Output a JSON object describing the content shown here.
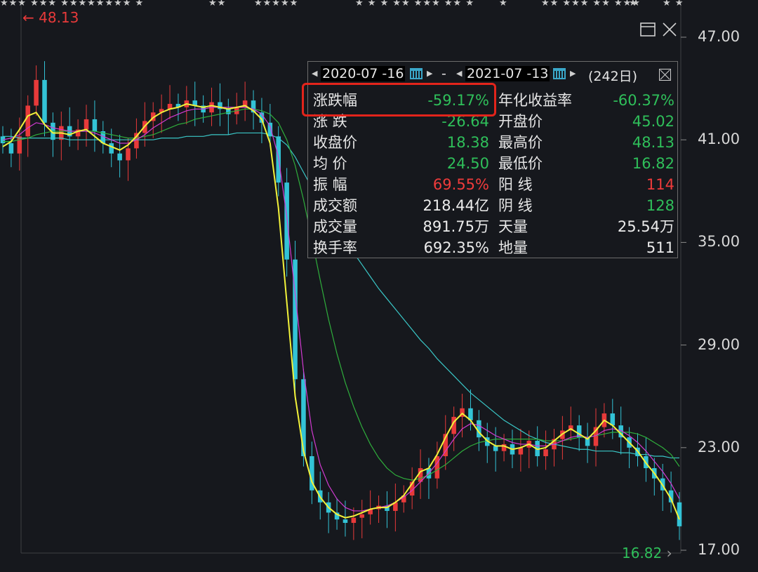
{
  "chart_data": {
    "type": "candlestick",
    "y_axis": {
      "ticks": [
        "47.00",
        "41.00",
        "35.00",
        "29.00",
        "23.00",
        "17.00"
      ],
      "ylim": [
        16.6,
        47.6
      ]
    },
    "max_marker": "48.13",
    "min_marker": "16.82",
    "closes": [
      40.8,
      40.2,
      41.2,
      43.0,
      44.5,
      42.0,
      41.0,
      41.8,
      41.2,
      41.6,
      42.2,
      41.5,
      40.8,
      40.2,
      39.8,
      40.5,
      41.4,
      42.1,
      42.6,
      42.8,
      43.1,
      42.9,
      43.3,
      43.0,
      42.6,
      43.2,
      42.8,
      42.5,
      42.9,
      43.3,
      42.6,
      42.0,
      41.2,
      38.5,
      34.0,
      27.0,
      22.5,
      20.5,
      19.8,
      19.2,
      18.8,
      18.6,
      18.9,
      19.1,
      19.4,
      19.6,
      19.3,
      19.8,
      20.2,
      21.0,
      21.8,
      21.2,
      22.5,
      23.8,
      24.8,
      25.3,
      24.6,
      23.6,
      23.1,
      22.8,
      23.2,
      22.6,
      23.0,
      23.4,
      22.5,
      22.9,
      23.5,
      24.0,
      24.3,
      23.6,
      23.1,
      24.2,
      25.0,
      24.3,
      23.6,
      23.0,
      22.5,
      21.8,
      21.2,
      20.5,
      19.8,
      18.4
    ],
    "ma_fast": [
      40.6,
      40.9,
      41.6,
      42.4,
      42.6,
      41.9,
      41.4,
      41.4,
      41.3,
      41.5,
      41.6,
      41.2,
      40.8,
      40.6,
      40.4,
      40.7,
      41.2,
      41.8,
      42.3,
      42.6,
      42.8,
      42.9,
      43.1,
      43.0,
      42.9,
      43.0,
      42.9,
      42.8,
      42.9,
      43.0,
      42.7,
      42.2,
      40.8,
      37.0,
      31.5,
      26.0,
      22.8,
      21.0,
      20.1,
      19.5,
      19.1,
      18.9,
      19.0,
      19.2,
      19.4,
      19.5,
      19.5,
      19.8,
      20.2,
      20.9,
      21.6,
      21.8,
      22.6,
      23.6,
      24.5,
      25.0,
      24.6,
      23.9,
      23.4,
      23.1,
      23.1,
      22.9,
      23.0,
      23.2,
      22.9,
      23.0,
      23.4,
      23.8,
      24.1,
      23.8,
      23.5,
      24.0,
      24.6,
      24.3,
      23.8,
      23.3,
      22.8,
      22.1,
      21.5,
      20.8,
      20.0,
      18.8
    ],
    "ma_mid": [
      41.0,
      41.1,
      41.3,
      41.7,
      42.0,
      41.9,
      41.7,
      41.6,
      41.5,
      41.5,
      41.5,
      41.4,
      41.2,
      41.0,
      40.8,
      40.8,
      41.0,
      41.3,
      41.7,
      42.0,
      42.3,
      42.5,
      42.7,
      42.8,
      42.8,
      42.9,
      42.9,
      42.9,
      42.9,
      42.9,
      42.8,
      42.5,
      41.8,
      40.0,
      36.5,
      32.0,
      27.5,
      24.0,
      22.0,
      20.8,
      20.0,
      19.5,
      19.3,
      19.3,
      19.4,
      19.5,
      19.6,
      19.8,
      20.1,
      20.5,
      21.0,
      21.5,
      22.1,
      22.8,
      23.5,
      24.1,
      24.4,
      24.3,
      24.0,
      23.7,
      23.5,
      23.3,
      23.2,
      23.2,
      23.1,
      23.1,
      23.2,
      23.4,
      23.6,
      23.7,
      23.6,
      23.7,
      24.0,
      24.1,
      24.0,
      23.7,
      23.3,
      22.8,
      22.2,
      21.6,
      20.9,
      20.0
    ],
    "ma_slow": [
      40.9,
      40.9,
      41.0,
      41.1,
      41.3,
      41.4,
      41.5,
      41.5,
      41.5,
      41.5,
      41.5,
      41.5,
      41.4,
      41.3,
      41.2,
      41.1,
      41.1,
      41.2,
      41.3,
      41.5,
      41.7,
      41.9,
      42.0,
      42.2,
      42.3,
      42.4,
      42.5,
      42.6,
      42.7,
      42.8,
      42.8,
      42.7,
      42.5,
      42.0,
      41.0,
      39.5,
      37.5,
      35.2,
      32.8,
      30.5,
      28.5,
      26.8,
      25.4,
      24.2,
      23.2,
      22.4,
      21.8,
      21.4,
      21.2,
      21.1,
      21.2,
      21.4,
      21.7,
      22.0,
      22.4,
      22.8,
      23.1,
      23.3,
      23.4,
      23.5,
      23.5,
      23.5,
      23.5,
      23.5,
      23.5,
      23.4,
      23.4,
      23.4,
      23.5,
      23.6,
      23.6,
      23.7,
      23.8,
      23.9,
      23.9,
      23.9,
      23.8,
      23.6,
      23.3,
      23.0,
      22.6,
      21.9
    ],
    "ma_long": [
      41.2,
      41.2,
      41.1,
      41.1,
      41.1,
      41.1,
      41.1,
      41.1,
      41.0,
      41.0,
      41.0,
      41.0,
      41.0,
      41.0,
      41.0,
      41.0,
      41.0,
      41.0,
      41.0,
      41.1,
      41.1,
      41.1,
      41.2,
      41.2,
      41.2,
      41.3,
      41.3,
      41.3,
      41.4,
      41.4,
      41.4,
      41.4,
      41.3,
      41.1,
      40.7,
      40.0,
      39.1,
      38.2,
      37.3,
      36.5,
      35.8,
      35.1,
      34.4,
      33.7,
      33.0,
      32.3,
      31.7,
      31.1,
      30.5,
      29.9,
      29.3,
      28.8,
      28.2,
      27.7,
      27.2,
      26.7,
      26.2,
      25.8,
      25.4,
      25.0,
      24.6,
      24.3,
      24.0,
      23.7,
      23.5,
      23.3,
      23.2,
      23.1,
      23.0,
      22.9,
      22.9,
      22.8,
      22.8,
      22.8,
      22.7,
      22.7,
      22.6,
      22.6,
      22.5,
      22.5,
      22.4,
      22.4
    ]
  },
  "top_marks": [
    {
      "text": "★★★ ★★★ ★★★★★★★★ ★"
    },
    {
      "text": "★★"
    },
    {
      "text": "★★★★★"
    },
    {
      "text": "★ ★ ★ ★★ ★★★ ★★ ★"
    },
    {
      "text": "★"
    },
    {
      "text": "★★ ★★★ ★★ ★★★"
    },
    {
      "text": "★"
    },
    {
      "text": "★ ★"
    }
  ],
  "panel": {
    "start_date": "2020-07 -16",
    "separator": "-",
    "end_date": "2021-07 -13",
    "days": "(242日)",
    "rows": [
      {
        "l1": "涨跌幅",
        "v1": "-59.17%",
        "c1": "green",
        "l2": "年化收益率",
        "v2": "-60.37%",
        "c2": "green"
      },
      {
        "l1": "涨  跌",
        "v1": "-26.64",
        "c1": "green",
        "l2": "开盘价",
        "v2": "45.02",
        "c2": "green"
      },
      {
        "l1": "收盘价",
        "v1": "18.38",
        "c1": "green",
        "l2": "最高价",
        "v2": "48.13",
        "c2": "green"
      },
      {
        "l1": "均  价",
        "v1": "24.50",
        "c1": "green",
        "l2": "最低价",
        "v2": "16.82",
        "c2": "green"
      },
      {
        "l1": "振  幅",
        "v1": "69.55%",
        "c1": "red",
        "l2": "阳  线",
        "v2": "114",
        "c2": "red"
      },
      {
        "l1": "成交额",
        "v1": "218.44亿",
        "c1": "white",
        "l2": "阴  线",
        "v2": "128",
        "c2": "green"
      },
      {
        "l1": "成交量",
        "v1": "891.75万",
        "c1": "white",
        "l2": "天量",
        "v2": "25.54万",
        "c2": "white"
      },
      {
        "l1": "换手率",
        "v1": "692.35%",
        "c1": "white",
        "l2": "地量",
        "v2": "511",
        "c2": "white"
      }
    ]
  },
  "colors": {
    "up": "#e83a3a",
    "down": "#33c3d6",
    "ma_fast": "#f2f23a",
    "ma_mid": "#d23ad2",
    "ma_slow": "#2fae3c",
    "ma_long": "#3ac7c7",
    "highlight": "#e3241b"
  }
}
